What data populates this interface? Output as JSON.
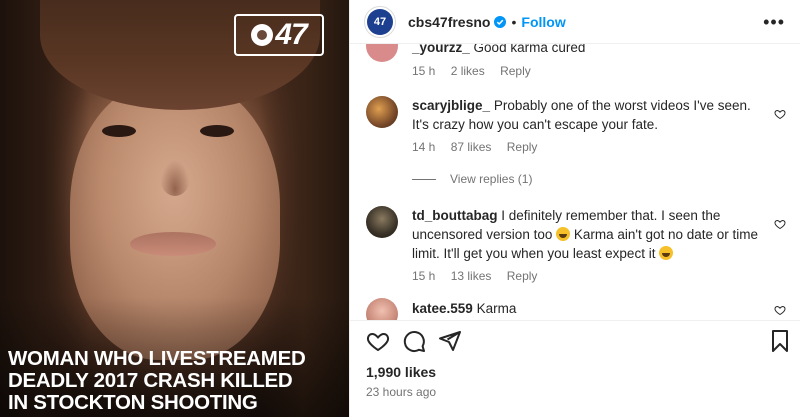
{
  "media": {
    "logo_text": "47",
    "headline_lines": [
      "WOMAN WHO LIVESTREAMED",
      "DEADLY 2017 CRASH KILLED",
      "IN STOCKTON SHOOTING"
    ]
  },
  "header": {
    "username": "cbs47fresno",
    "verified": true,
    "separator": "•",
    "follow_label": "Follow",
    "more_label": "•••"
  },
  "comments": [
    {
      "username": "_yourzz_",
      "text": "Good karma cured",
      "time": "15 h",
      "likes": "2 likes",
      "reply": "Reply",
      "avatar_color": "#d98b8b"
    },
    {
      "username": "scaryjblige_",
      "text": "Probably one of the worst videos I've seen. It's crazy how you can't escape your fate.",
      "time": "14 h",
      "likes": "87 likes",
      "reply": "Reply",
      "avatar_color": "#7a4a2a"
    },
    {
      "username": "td_bouttabag",
      "text_a": "I definitely remember that. I seen the uncensored version too",
      "text_b": "Karma ain't got no date or time limit. It'll get you when you least expect it",
      "time": "15 h",
      "likes": "13 likes",
      "reply": "Reply",
      "avatar_color": "#3a3328"
    },
    {
      "username": "katee.559",
      "text": "Karma",
      "avatar_color": "#c98a7a"
    }
  ],
  "view_replies": "View replies (1)",
  "icons": {
    "like": "heart-icon",
    "comment": "comment-icon",
    "share": "share-icon",
    "save": "bookmark-icon"
  },
  "stats": {
    "likes": "1,990 likes",
    "posted": "23 hours ago"
  },
  "colors": {
    "follow": "#0095f6",
    "verified": "#0095f6",
    "meta": "#737373"
  }
}
